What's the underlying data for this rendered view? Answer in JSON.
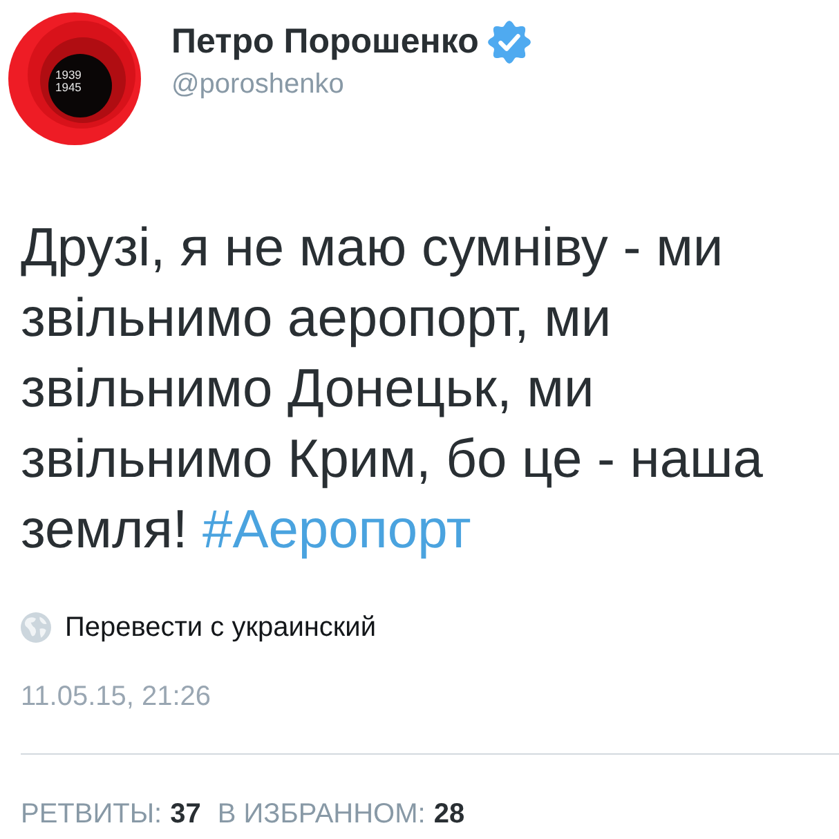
{
  "author": {
    "avatar": {
      "lines": [
        "1939",
        "1945"
      ]
    },
    "name": "Петро Порошенко",
    "verified": true,
    "handle": "@poroshenko"
  },
  "tweet": {
    "text": "Друзі, я не маю сумніву - ми звільнимо аеропорт, ми звільнимо Донецьк, ми звільнимо Крим, бо це - наша земля!",
    "hashtag": "#Аеропорт"
  },
  "translate": {
    "label": "Перевести с украинский"
  },
  "timestamp": "11.05.15, 21:26",
  "stats": [
    {
      "label": "РЕТВИТЫ:",
      "count": "37"
    },
    {
      "label": "В ИЗБРАННОМ:",
      "count": "28"
    }
  ]
}
